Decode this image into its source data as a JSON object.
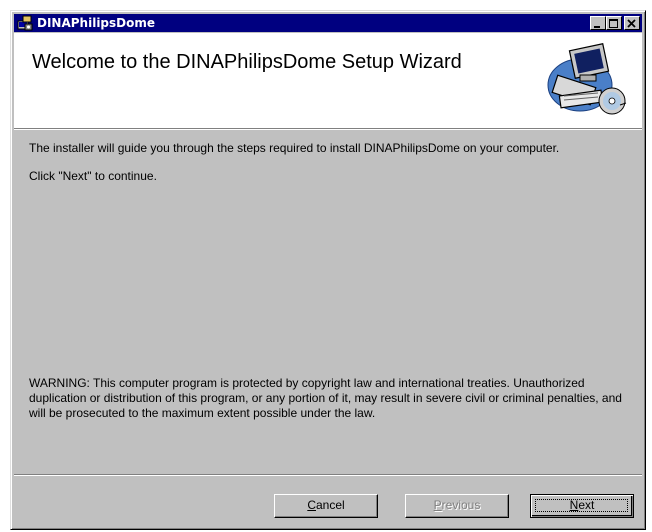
{
  "window": {
    "title": "DINAPhilipsDome"
  },
  "header": {
    "title": "Welcome to the DINAPhilipsDome Setup Wizard",
    "art_icon": "computer-with-cd-icon"
  },
  "content": {
    "intro": "The installer will guide you through the steps required to install DINAPhilipsDome on your computer.",
    "instruction": "Click \"Next\" to continue.",
    "warning": "WARNING: This computer program is protected by copyright law and international treaties. Unauthorized duplication or distribution of this program, or any portion of it, may result in severe civil or criminal penalties, and will be prosecuted to the maximum extent possible under the law."
  },
  "buttons": {
    "cancel": {
      "first": "C",
      "rest": "ancel"
    },
    "previous": {
      "first": "P",
      "rest": "revious"
    },
    "next": {
      "first": "N",
      "rest": "ext"
    }
  },
  "titlebar_buttons": [
    "minimize-icon",
    "maximize-icon",
    "close-icon"
  ]
}
